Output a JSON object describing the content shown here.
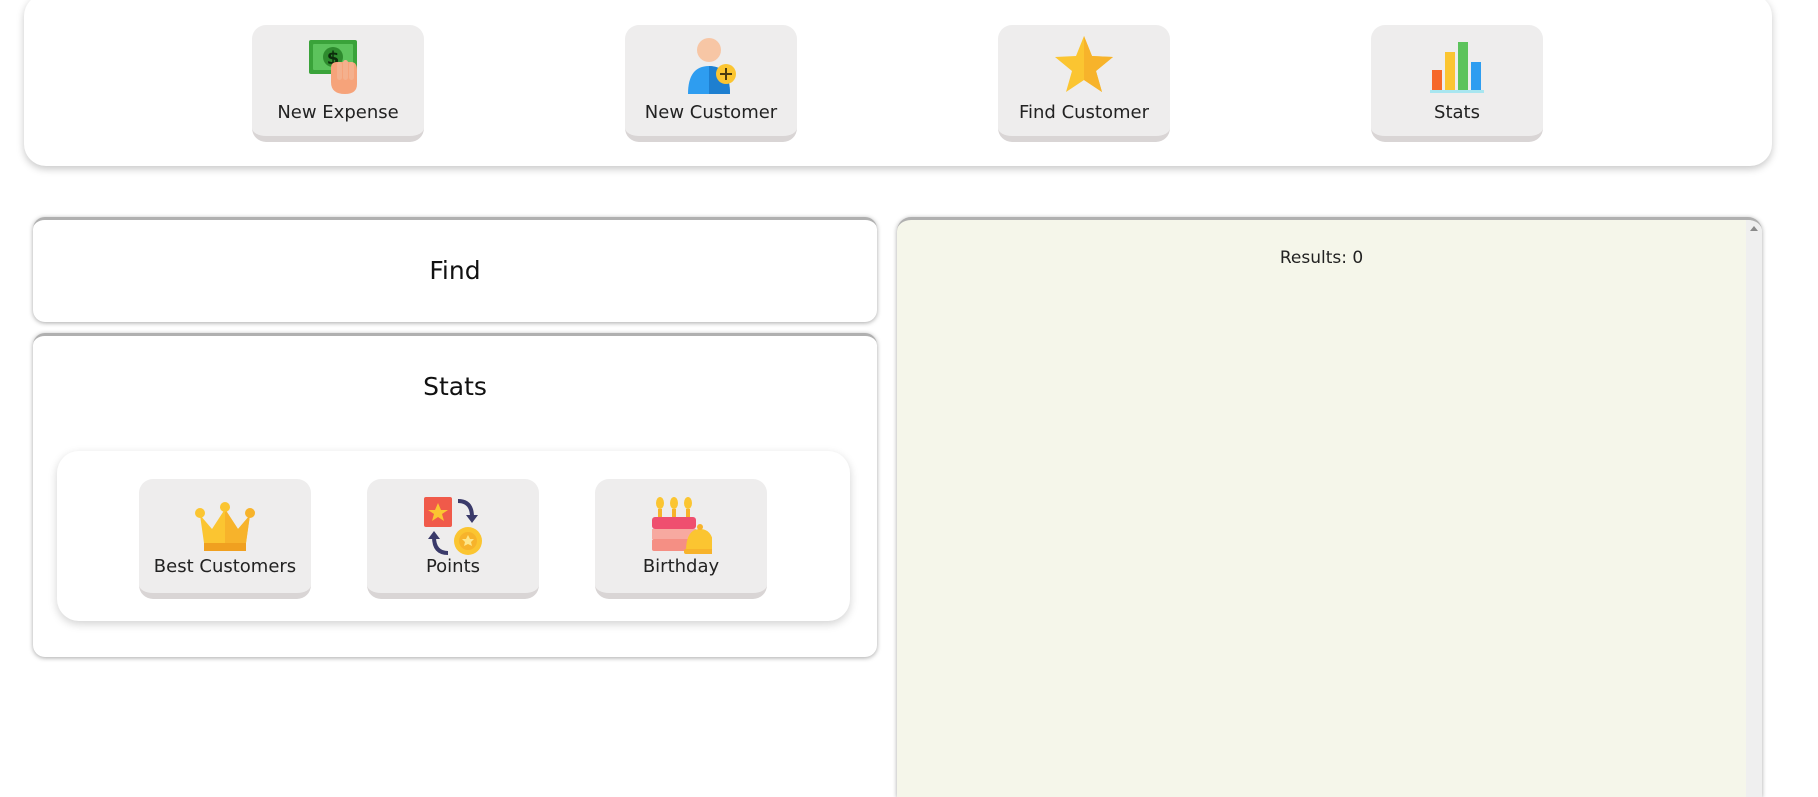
{
  "toolbar": {
    "buttons": [
      {
        "label": "New Expense",
        "icon": "money-hand-icon"
      },
      {
        "label": "New Customer",
        "icon": "add-user-icon"
      },
      {
        "label": "Find Customer",
        "icon": "star-icon"
      },
      {
        "label": "Stats",
        "icon": "bar-chart-icon"
      }
    ]
  },
  "find_panel": {
    "title": "Find"
  },
  "stats_panel": {
    "title": "Stats",
    "buttons": [
      {
        "label": "Best Customers",
        "icon": "crown-icon"
      },
      {
        "label": "Points",
        "icon": "points-exchange-icon"
      },
      {
        "label": "Birthday",
        "icon": "birthday-cake-bell-icon"
      }
    ]
  },
  "results": {
    "count_text": "Results: 0"
  },
  "colors": {
    "button_bg": "#eeeded",
    "results_bg": "#f5f6ea",
    "accent_yellow": "#fbc531",
    "accent_blue": "#2e9df0"
  }
}
